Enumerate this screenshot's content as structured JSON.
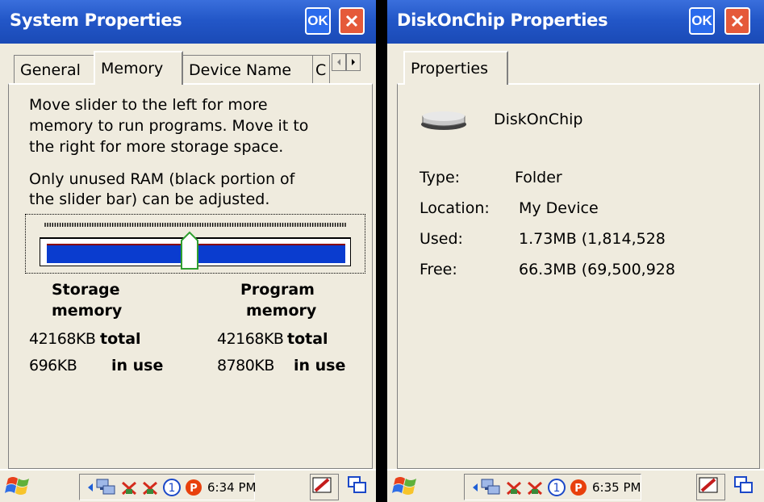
{
  "left": {
    "title": "System Properties",
    "ok_label": "OK",
    "tabs": [
      {
        "label": "General"
      },
      {
        "label": "Memory"
      },
      {
        "label": "Device Name"
      },
      {
        "label": "C"
      }
    ],
    "description_1": [
      "Move slider to the left for more",
      "memory to run programs. Move it to",
      "the right for more storage space."
    ],
    "description_2": [
      "Only unused RAM (black portion of",
      "the slider bar) can be adjusted."
    ],
    "storage_heading": [
      "Storage",
      "memory"
    ],
    "program_heading": [
      "Program",
      "memory"
    ],
    "storage_total_value": "42168KB",
    "storage_total_label": "total",
    "storage_inuse_value": "696KB",
    "storage_inuse_label": "in use",
    "program_total_value": "42168KB",
    "program_total_label": "total",
    "program_inuse_value": "8780KB",
    "program_inuse_label": "in use",
    "clock": "6:34 PM",
    "slider_position": 0.48
  },
  "right": {
    "title": "DiskOnChip Properties",
    "ok_label": "OK",
    "tab_label": "Properties",
    "name": "DiskOnChip",
    "rows": [
      {
        "label": "Type:",
        "value": "Folder"
      },
      {
        "label": "Location:",
        "value": "My Device"
      },
      {
        "label": "Used:",
        "value": "1.73MB (1,814,528"
      },
      {
        "label": "Free:",
        "value": "66.3MB (69,500,928"
      }
    ],
    "clock": "6:35 PM"
  },
  "colors": {
    "title_bar": "#2357c8",
    "slider_fill": "#0a3ccf",
    "dialog_bg": "#efebde"
  },
  "icons": [
    "windows-start-icon",
    "scroll-left-icon",
    "network-icon",
    "disconnected-icon",
    "badge-1-icon",
    "p-badge-icon",
    "pen-icon",
    "window-switch-icon",
    "drive-icon"
  ]
}
